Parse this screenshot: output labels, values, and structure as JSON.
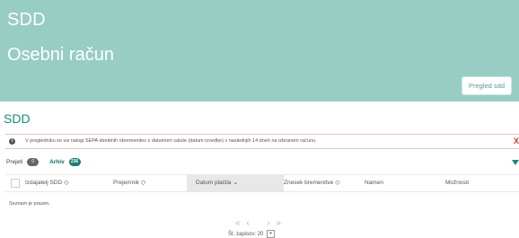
{
  "header": {
    "app_title": "SDD",
    "page_title": "Osebni račun",
    "pregled_button": "Pregled sdd"
  },
  "section": {
    "title": "SDD"
  },
  "info": {
    "icon": "info-icon",
    "text": "V pregledniku so vsi nalogi SEPA direktnih obremenitev z datumom valute (datum izvedbe) v naslednjih 14 dneh na izbranem računu.",
    "close": "X"
  },
  "tabs": [
    {
      "label": "Prejeti",
      "count": "0"
    },
    {
      "label": "Arhiv",
      "count": "236"
    }
  ],
  "table": {
    "columns": [
      "Izdajatelj SDD",
      "Prejemnik",
      "Datum plačila",
      "Znesek bremenitve",
      "Namen",
      "Možnosti"
    ],
    "empty_text": "Seznam je prazen."
  },
  "pagination": {
    "first": "«",
    "prev": "‹",
    "next": "›",
    "last": "»",
    "records_label": "Št. zapisov:",
    "records_value": "20"
  }
}
